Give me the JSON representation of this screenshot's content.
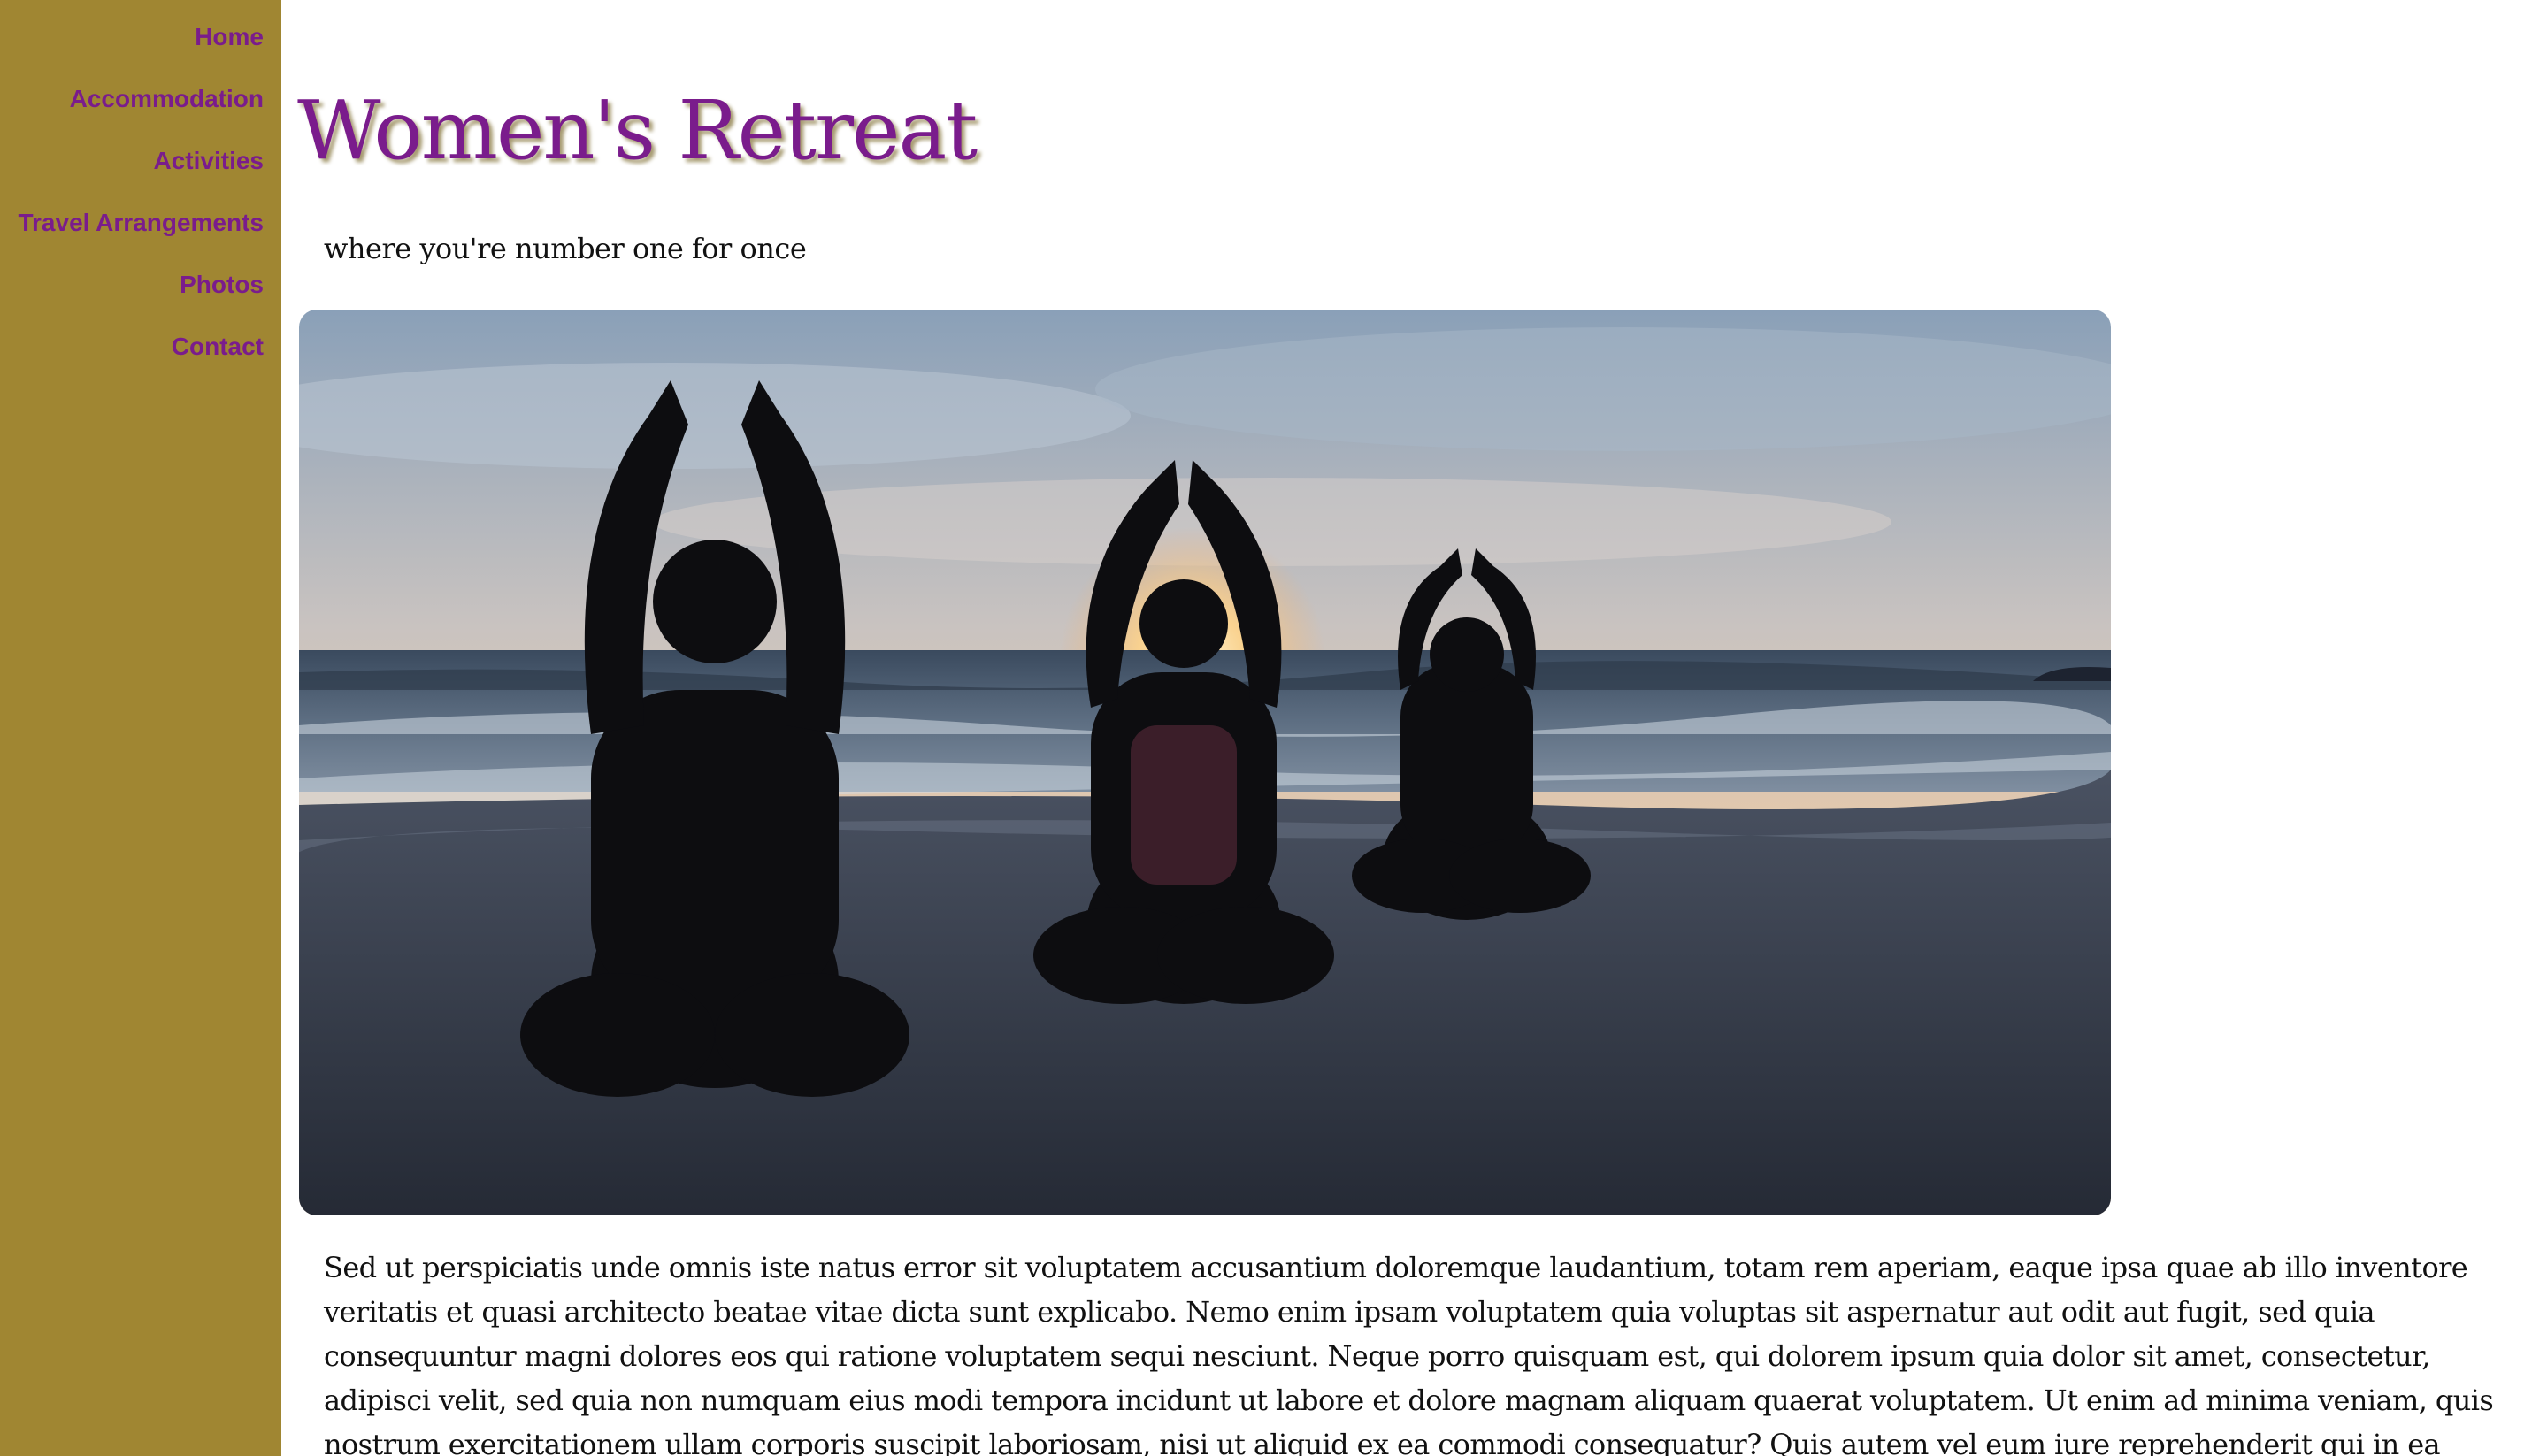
{
  "nav": {
    "items": [
      {
        "label": "Home"
      },
      {
        "label": "Accommodation"
      },
      {
        "label": "Activities"
      },
      {
        "label": "Travel Arrangements"
      },
      {
        "label": "Photos"
      },
      {
        "label": "Contact"
      }
    ]
  },
  "header": {
    "title": "Women's Retreat",
    "tagline": "where you're number one for once"
  },
  "hero": {
    "image_icon": "yoga-beach-sunset-photo"
  },
  "content": {
    "paragraph": "Sed ut perspiciatis unde omnis iste natus error sit voluptatem accusantium doloremque laudantium, totam rem aperiam, eaque ipsa quae ab illo inventore veritatis et quasi architecto beatae vitae dicta sunt explicabo. Nemo enim ipsam voluptatem quia voluptas sit aspernatur aut odit aut fugit, sed quia consequuntur magni dolores eos qui ratione voluptatem sequi nesciunt. Neque porro quisquam est, qui dolorem ipsum quia dolor sit amet, consectetur, adipisci velit, sed quia non numquam eius modi tempora incidunt ut labore et dolore magnam aliquam quaerat voluptatem. Ut enim ad minima veniam, quis nostrum exercitationem ullam corporis suscipit laboriosam, nisi ut aliquid ex ea commodi consequatur? Quis autem vel eum iure reprehenderit qui in ea voluptate velit esse quam nihil molestiae consequatur, vel illum qui dolorem eum fugiat quo voluptas nulla"
  },
  "colors": {
    "sidebar_bg": "#a08632",
    "accent_purple": "#7a1c8c",
    "text": "#111111"
  }
}
